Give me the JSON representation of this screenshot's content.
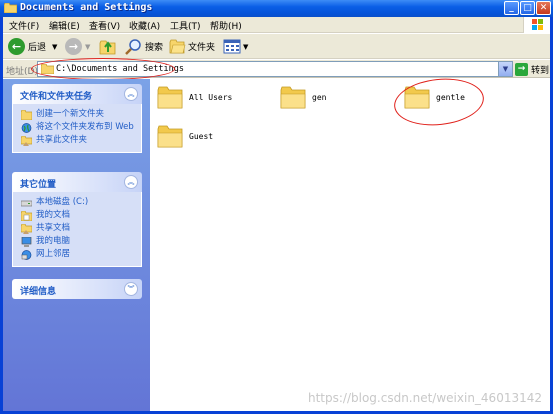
{
  "window": {
    "title": "Documents and Settings",
    "buttons": {
      "minimize": "_",
      "maximize": "□",
      "close": "✕"
    }
  },
  "menu": [
    "文件(F)",
    "编辑(E)",
    "查看(V)",
    "收藏(A)",
    "工具(T)",
    "帮助(H)"
  ],
  "toolbar": {
    "back": "后退",
    "search": "搜索",
    "folders": "文件夹"
  },
  "address": {
    "label": "地址(D)",
    "path": "C:\\Documents and Settings",
    "go": "转到"
  },
  "sidebar": {
    "tasks": {
      "title": "文件和文件夹任务",
      "items": [
        "创建一个新文件夹",
        "将这个文件夹发布到 Web",
        "共享此文件夹"
      ]
    },
    "places": {
      "title": "其它位置",
      "items": [
        "本地磁盘 (C:)",
        "我的文档",
        "共享文档",
        "我的电脑",
        "网上邻居"
      ]
    },
    "details": {
      "title": "详细信息"
    }
  },
  "folders": [
    "All Users",
    "gen",
    "gentle",
    "Guest"
  ],
  "watermark": "https://blog.csdn.net/weixin_46013142",
  "colors": {
    "titlebar": "#0a5ee6",
    "sidebar": "#7ba2e7",
    "link": "#215dc6",
    "annotation": "#e0201a"
  }
}
